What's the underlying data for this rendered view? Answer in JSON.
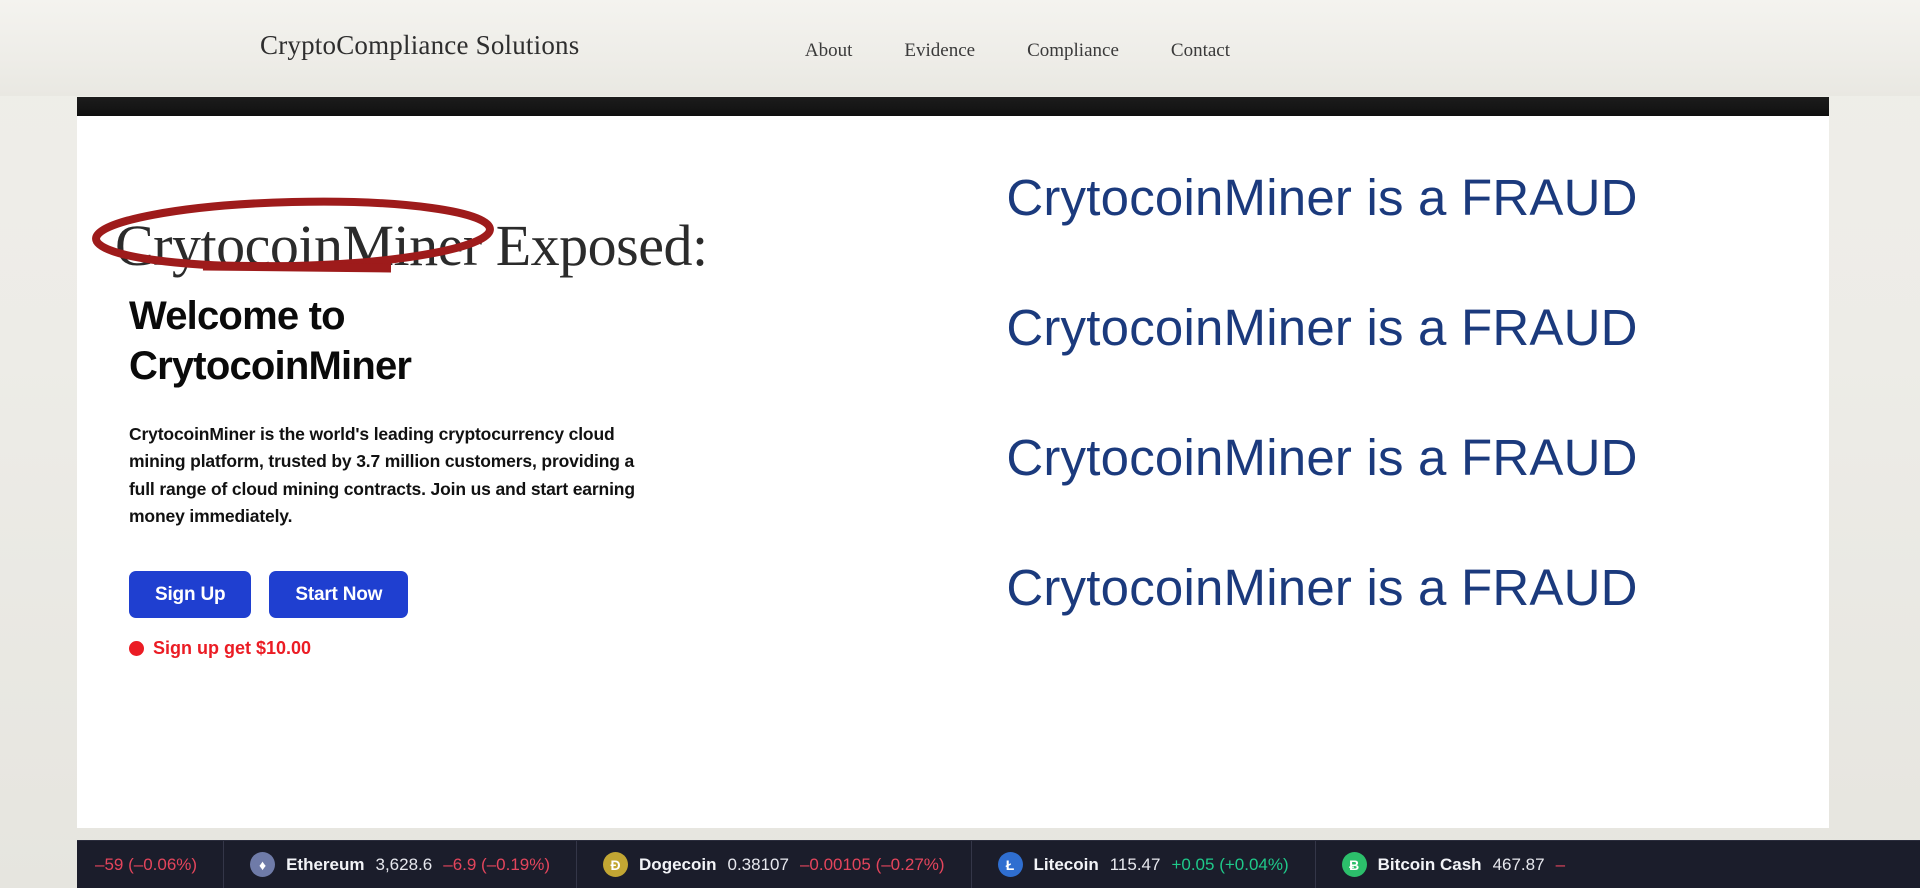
{
  "site_header": {
    "brand": "CryptoCompliance Solutions",
    "nav": [
      {
        "label": "About"
      },
      {
        "label": "Evidence"
      },
      {
        "label": "Compliance"
      },
      {
        "label": "Contact"
      }
    ]
  },
  "annotation": {
    "ellipse_color": "#9e1b1b",
    "circled_text": "CrytocoinMiner"
  },
  "hero": {
    "exposed_heading": "CrytocoinMiner Exposed:",
    "welcome_heading": "Welcome to CrytocoinMiner",
    "paragraph": "CrytocoinMiner is the world's leading cryptocurrency cloud mining platform, trusted by 3.7 million customers, providing a full range of cloud mining contracts. Join us and start earning money immediately.",
    "buttons": [
      {
        "label": "Sign Up",
        "color": "#1f3fd0"
      },
      {
        "label": "Start Now",
        "color": "#1f3fd0"
      }
    ],
    "promo": {
      "text": "Sign up get $10.00",
      "color": "#eb1c24"
    }
  },
  "fraud_overlay": {
    "color": "#1b3a7d",
    "lines": [
      "CrytocoinMiner is a FRAUD",
      "CrytocoinMiner is a FRAUD",
      "CrytocoinMiner is a FRAUD",
      "CrytocoinMiner is a FRAUD"
    ]
  },
  "ticker": {
    "partial_left": "–59 (–0.06%)",
    "items": [
      {
        "icon": "ethereum-icon",
        "symbol": "♦",
        "icon_bg": "#6f7ba8",
        "name": "Ethereum",
        "price": "3,628.6",
        "change": "–6.9 (–0.19%)",
        "direction": "down"
      },
      {
        "icon": "dogecoin-icon",
        "symbol": "Ð",
        "icon_bg": "#c2a633",
        "name": "Dogecoin",
        "price": "0.38107",
        "change": "–0.00105 (–0.27%)",
        "direction": "down"
      },
      {
        "icon": "litecoin-icon",
        "symbol": "Ł",
        "icon_bg": "#2f6ed0",
        "name": "Litecoin",
        "price": "115.47",
        "change": "+0.05 (+0.04%)",
        "direction": "up"
      },
      {
        "icon": "bitcoin-cash-icon",
        "symbol": "Ƀ",
        "icon_bg": "#2cbf6b",
        "name": "Bitcoin Cash",
        "price": "467.87",
        "change": "–",
        "direction": "down"
      }
    ]
  }
}
